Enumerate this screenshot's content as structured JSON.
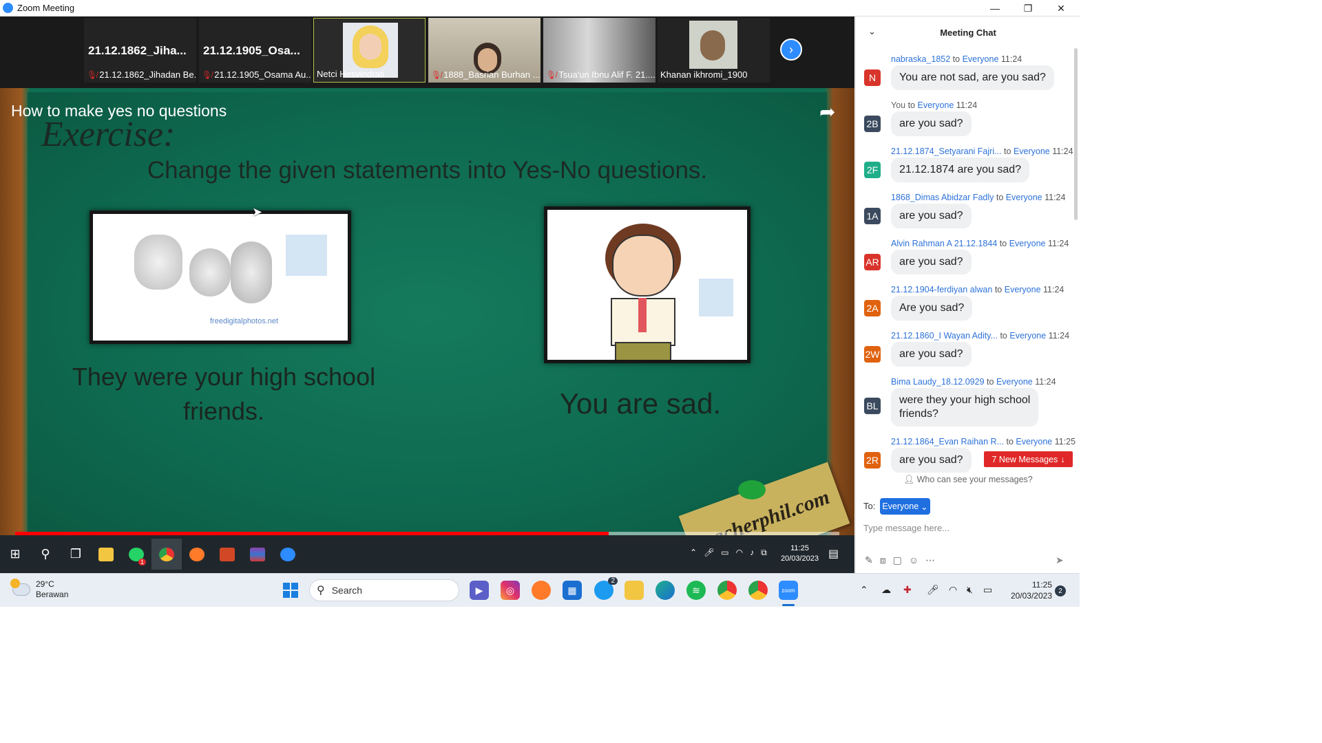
{
  "window": {
    "title": "Zoom Meeting",
    "minimize": "—",
    "maximize": "❐",
    "close": "✕"
  },
  "gallery": {
    "tiles": [
      {
        "big_name": "21.12.1862_Jiha...",
        "label": "21.12.1862_Jihadan Be..."
      },
      {
        "big_name": "21.12.1905_Osa...",
        "label": "21.12.1905_Osama Au..."
      },
      {
        "label": "Netci Hesvindrati"
      },
      {
        "label": "1888_Basrian Burhan ..."
      },
      {
        "label": "Tsua'un Ibnu Alif F. 21...."
      },
      {
        "label": "Khanan ikhromi_1900"
      }
    ],
    "next_icon": "chevron-right-icon"
  },
  "video": {
    "title": "How to make yes no questions",
    "share_icon": "share-arrow-icon",
    "progress": 0.72,
    "slide": {
      "heading": "Exercise:",
      "instruction": "Change the given statements into Yes-No questions.",
      "statement_1_line_1": "They were your high school",
      "statement_1_line_2": "friends.",
      "statement_2": "You are sad.",
      "watermark": "teacherphil.com",
      "img_credit": "freedigitalphotos.net"
    }
  },
  "shared_taskbar": {
    "time": "11:25",
    "date": "20/03/2023",
    "whatsapp_badge": "1"
  },
  "chat": {
    "title": "Meeting Chat",
    "messages": [
      {
        "from": "nabraska_1852",
        "to": "Everyone",
        "time": "11:24",
        "avatar": "N",
        "color": "#d9342b",
        "text": "You are not sad, are you sad?"
      },
      {
        "from": "You",
        "to": "Everyone",
        "time": "11:24",
        "avatar": "2B",
        "color": "#3b4a5e",
        "text": "are you sad?",
        "self": true
      },
      {
        "from": "21.12.1874_Setyarani Fajri...",
        "to": "Everyone",
        "time": "11:24",
        "avatar": "2F",
        "color": "#1fae8a",
        "text": "21.12.1874 are you sad?"
      },
      {
        "from": "1868_Dimas Abidzar Fadly",
        "to": "Everyone",
        "time": "11:24",
        "avatar": "1A",
        "color": "#3b4a5e",
        "text": "are you sad?"
      },
      {
        "from": "Alvin Rahman A 21.12.1844",
        "to": "Everyone",
        "time": "11:24",
        "avatar": "AR",
        "color": "#d9342b",
        "text": "are you sad?"
      },
      {
        "from": "21.12.1904-ferdiyan alwan",
        "to": "Everyone",
        "time": "11:24",
        "avatar": "2A",
        "color": "#e0620f",
        "text": "Are you sad?"
      },
      {
        "from": "21.12.1860_I Wayan Adity...",
        "to": "Everyone",
        "time": "11:24",
        "avatar": "2W",
        "color": "#e0620f",
        "text": "are you sad?"
      },
      {
        "from": "Bima Laudy_18.12.0929",
        "to": "Everyone",
        "time": "11:24",
        "avatar": "BL",
        "color": "#3b4a5e",
        "text_1": "were they your high school",
        "text_2": "friends?"
      },
      {
        "from": "21.12.1864_Evan Raihan R...",
        "to": "Everyone",
        "time": "11:25",
        "avatar": "2R",
        "color": "#e0620f",
        "text": "are you sad?"
      }
    ],
    "to_word": "to",
    "new_messages": "7 New Messages",
    "who_can_see": "Who can see your messages?",
    "to_label": "To:",
    "recipient": "Everyone",
    "input_placeholder": "Type message here..."
  },
  "taskbar": {
    "temperature": "29°C",
    "weather": "Berawan",
    "search_label": "Search",
    "twitter_badge": "2",
    "time": "11:25",
    "date": "20/03/2023",
    "notifications": "2"
  }
}
